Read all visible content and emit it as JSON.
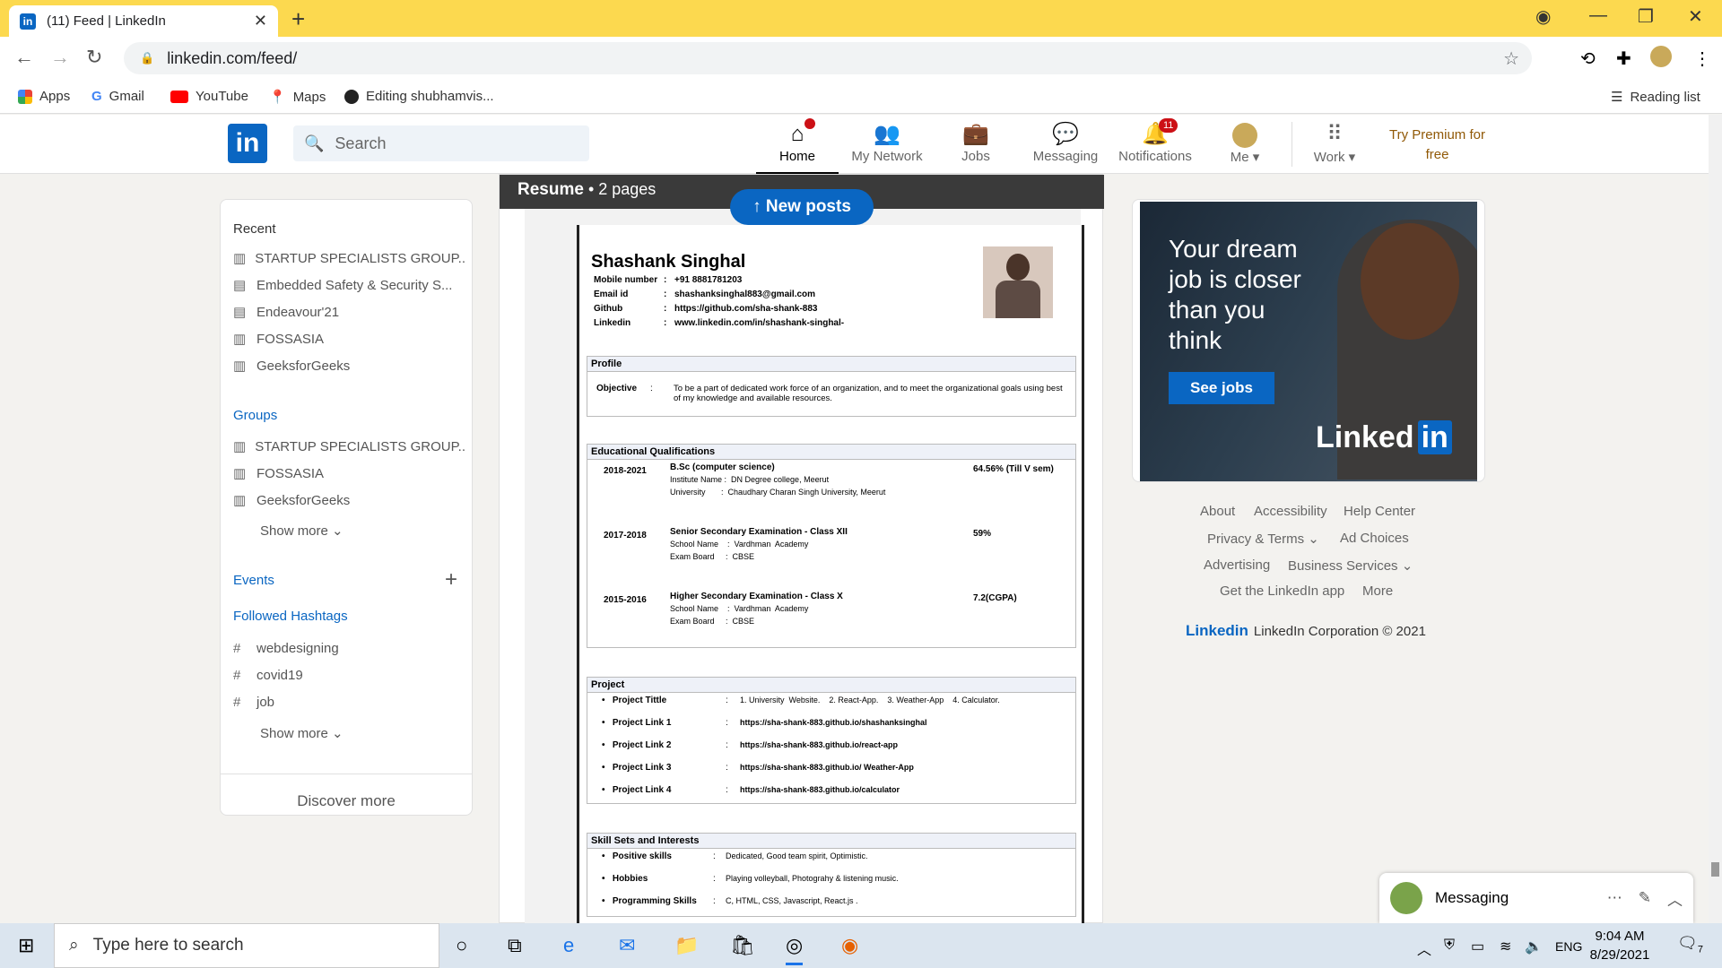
{
  "browser": {
    "tab_title": "(11) Feed | LinkedIn",
    "url": "linkedin.com/feed/",
    "bookmarks": [
      "Apps",
      "Gmail",
      "YouTube",
      "Maps",
      "Editing shubhamvis..."
    ],
    "reading_list": "Reading list"
  },
  "nav": {
    "search_placeholder": "Search",
    "items": [
      "Home",
      "My Network",
      "Jobs",
      "Messaging",
      "Notifications",
      "Me",
      "Work"
    ],
    "home_badge": "",
    "notifications_badge": "11",
    "premium": "Try Premium for free"
  },
  "left": {
    "recent_title": "Recent",
    "recent": [
      "STARTUP SPECIALISTS GROUP...",
      "Embedded Safety & Security S...",
      "Endeavour'21",
      "FOSSASIA",
      "GeeksforGeeks"
    ],
    "groups_title": "Groups",
    "groups": [
      "STARTUP SPECIALISTS GROUP...",
      "FOSSASIA",
      "GeeksforGeeks"
    ],
    "show_more": "Show more",
    "events_title": "Events",
    "hashtags_title": "Followed Hashtags",
    "hashtags": [
      "webdesigning",
      "covid19",
      "job"
    ],
    "discover": "Discover more"
  },
  "doc": {
    "title": "Resume",
    "pages": "• 2 pages",
    "new_posts": "New posts"
  },
  "resume": {
    "name": "Shashank Singhal",
    "contact": [
      {
        "k": "Mobile number",
        "v": "+91 8881781203"
      },
      {
        "k": "Email id",
        "v": "shashanksinghal883@gmail.com"
      },
      {
        "k": "Github",
        "v": "https://github.com/sha-shank-883"
      },
      {
        "k": "Linkedin",
        "v": "www.linkedin.com/in/shashank-singhal-"
      }
    ],
    "profile_title": "Profile",
    "objective_label": "Objective",
    "objective": "To be a part of dedicated work force of an organization, and to meet the organizational goals using best of my knowledge and available resources.",
    "edu_title": "Educational Qualifications",
    "edu": [
      {
        "year": "2018-2021",
        "degree": "B.Sc (computer science)",
        "l1": "Institute Name :  DN Degree college, Meerut",
        "l2": "University       :  Chaudhary Charan Singh University, Meerut",
        "score": "64.56% (Till V sem)"
      },
      {
        "year": "2017-2018",
        "degree": "Senior Secondary Examination - Class XII",
        "l1": "School Name    :  Vardhman  Academy",
        "l2": "Exam Board     :  CBSE",
        "score": "59%"
      },
      {
        "year": "2015-2016",
        "degree": "Higher Secondary Examination - Class X",
        "l1": "School Name    :  Vardhman  Academy",
        "l2": "Exam Board     :  CBSE",
        "score": "7.2(CGPA)"
      }
    ],
    "project_title": "Project",
    "projects": [
      {
        "k": "Project  Tittle",
        "v": "1. University  Website.    2. React-App.    3. Weather-App    4. Calculator."
      },
      {
        "k": "Project  Link  1",
        "v": "https://sha-shank-883.github.io/shashanksinghal"
      },
      {
        "k": "Project  Link  2",
        "v": "https://sha-shank-883.github.io/react-app"
      },
      {
        "k": "Project  Link  3",
        "v": "https://sha-shank-883.github.io/ Weather-App"
      },
      {
        "k": "Project  Link  4",
        "v": "https://sha-shank-883.github.io/calculator"
      }
    ],
    "skills_title": "Skill Sets and Interests",
    "skills": [
      {
        "k": "Positive skills",
        "v": "Dedicated, Good team spirit, Optimistic."
      },
      {
        "k": "Hobbies",
        "v": "Playing volleyball, Photograhy & listening music."
      },
      {
        "k": "Programming Skills",
        "v": "C, HTML, CSS, Javascript, React.js ."
      }
    ]
  },
  "ad": {
    "headline": "Your dream job is closer than you think",
    "button": "See jobs",
    "brand_a": "Linked",
    "brand_b": "in"
  },
  "footer": {
    "links": [
      "About",
      "Accessibility",
      "Help Center",
      "Privacy & Terms",
      "Ad Choices",
      "Advertising",
      "Business Services",
      "Get the LinkedIn app",
      "More"
    ],
    "corp_logo": "Linkedin",
    "corp": "LinkedIn Corporation © 2021"
  },
  "messaging": {
    "label": "Messaging"
  },
  "taskbar": {
    "search": "Type here to search",
    "lang": "ENG",
    "time": "9:04 AM",
    "date": "8/29/2021",
    "notif_count": "7"
  },
  "colors": {
    "brand": "#0a66c2",
    "tabbar": "#fcd94f",
    "badge": "#cc1016"
  }
}
